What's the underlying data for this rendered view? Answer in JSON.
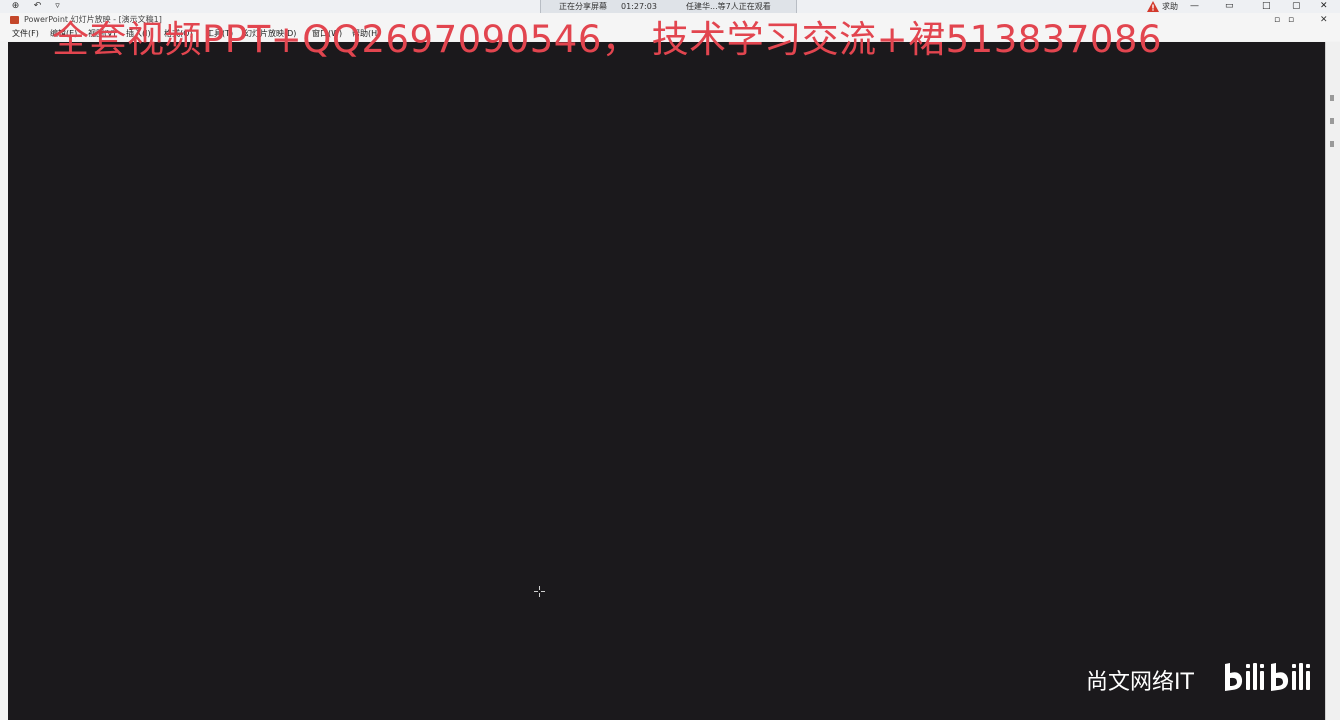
{
  "share_bar": {
    "center_status": "正在分享屏幕",
    "timer": "01:27:03",
    "viewers": "任建华...等7人正在观看",
    "warning_label": "求助"
  },
  "window": {
    "title": "PowerPoint 幻灯片放映 - [演示文稿1]"
  },
  "menu": {
    "items": [
      "文件(F)",
      "编辑(E)",
      "视图(V)",
      "插入(I)",
      "格式(O)",
      "工具(T)",
      "幻灯片放映(D)",
      "窗口(W)",
      "帮助(H)"
    ]
  },
  "watermark": {
    "text": "全套视频PPT+QQ2697090546， 技术学习交流+裙513837086"
  },
  "brand": {
    "name": "尚文网络IT"
  },
  "colors": {
    "stage": "#1b191c",
    "watermark": "#e2454f",
    "brand_text": "#ffffff"
  }
}
